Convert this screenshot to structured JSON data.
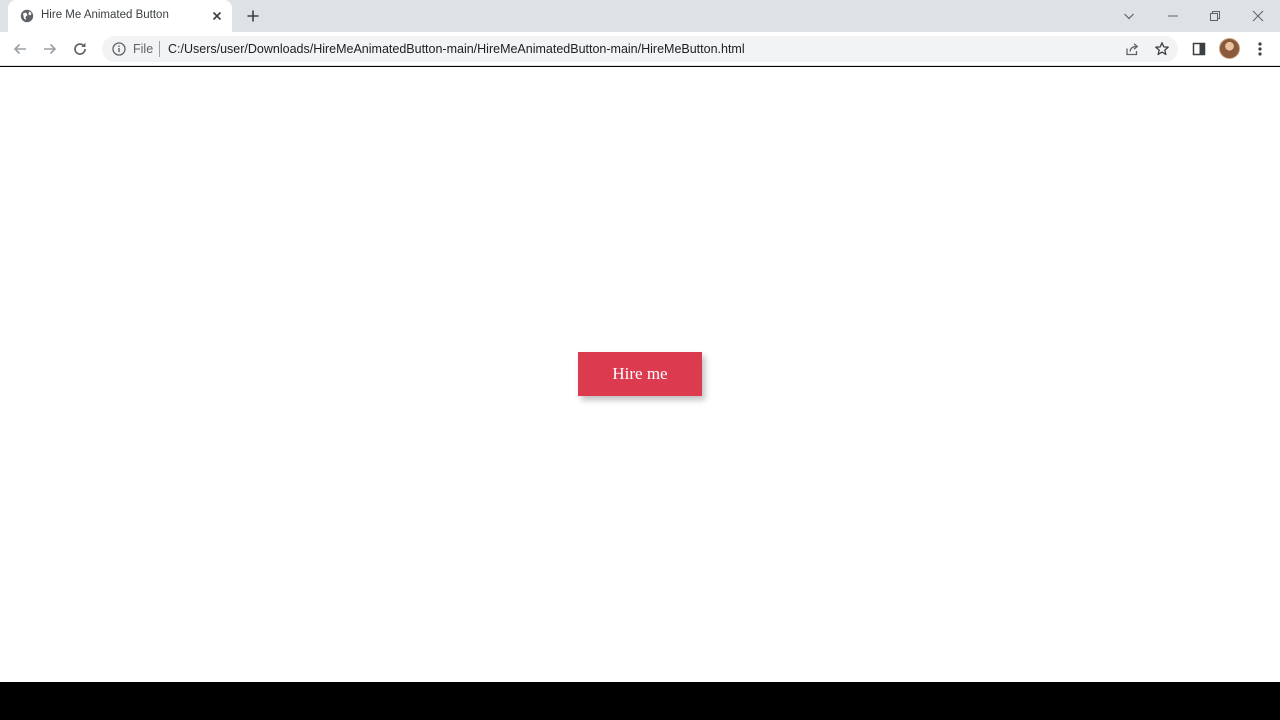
{
  "browser": {
    "tab": {
      "title": "Hire Me Animated Button",
      "favicon": "globe-icon"
    },
    "toolbar": {
      "scheme_label": "File",
      "url": "C:/Users/user/Downloads/HireMeAnimatedButton-main/HireMeAnimatedButton-main/HireMeButton.html"
    }
  },
  "page": {
    "button_label": "Hire me",
    "button_color": "#dc3a4f",
    "background_color": "#ffffff"
  }
}
